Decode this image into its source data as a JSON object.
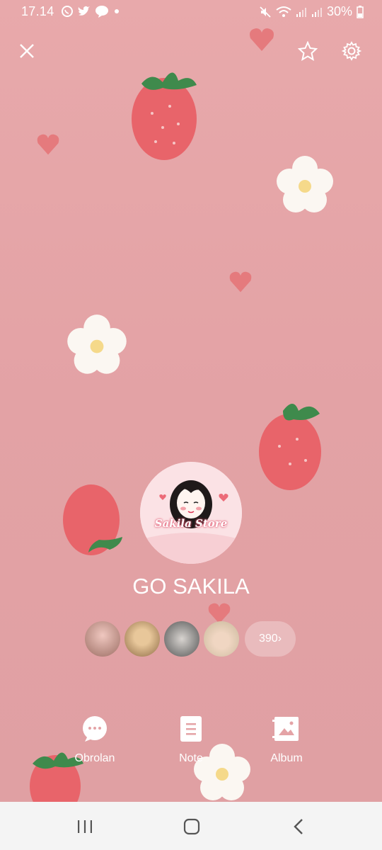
{
  "status_bar": {
    "time": "17.14",
    "notification_icons": [
      "whatsapp-icon",
      "twitter-icon",
      "line-icon",
      "dot-icon"
    ],
    "system_icons": [
      "mute-icon",
      "wifi-icon",
      "signal-icon",
      "signal-icon",
      "battery-icon"
    ],
    "battery": "30%"
  },
  "header": {
    "close_icon": "close-icon",
    "favorite_icon": "star-icon",
    "settings_icon": "gear-icon"
  },
  "profile": {
    "name": "GO SAKILA",
    "avatar_text": "Sakila Store",
    "friends_count": "390",
    "friends_chevron": "›",
    "friend_avatars": [
      "friend-avatar-1",
      "friend-avatar-2",
      "friend-avatar-3",
      "friend-avatar-4"
    ]
  },
  "actions": [
    {
      "label": "Obrolan",
      "icon": "chat-bubble-icon"
    },
    {
      "label": "Note",
      "icon": "note-icon"
    },
    {
      "label": "Album",
      "icon": "album-icon"
    }
  ],
  "nav": {
    "recents_icon": "recents-icon",
    "home_icon": "home-icon",
    "back_icon": "back-icon"
  },
  "colors": {
    "background": "#e4a3a6",
    "text": "#ffffff",
    "navbar": "#f4f4f4"
  }
}
